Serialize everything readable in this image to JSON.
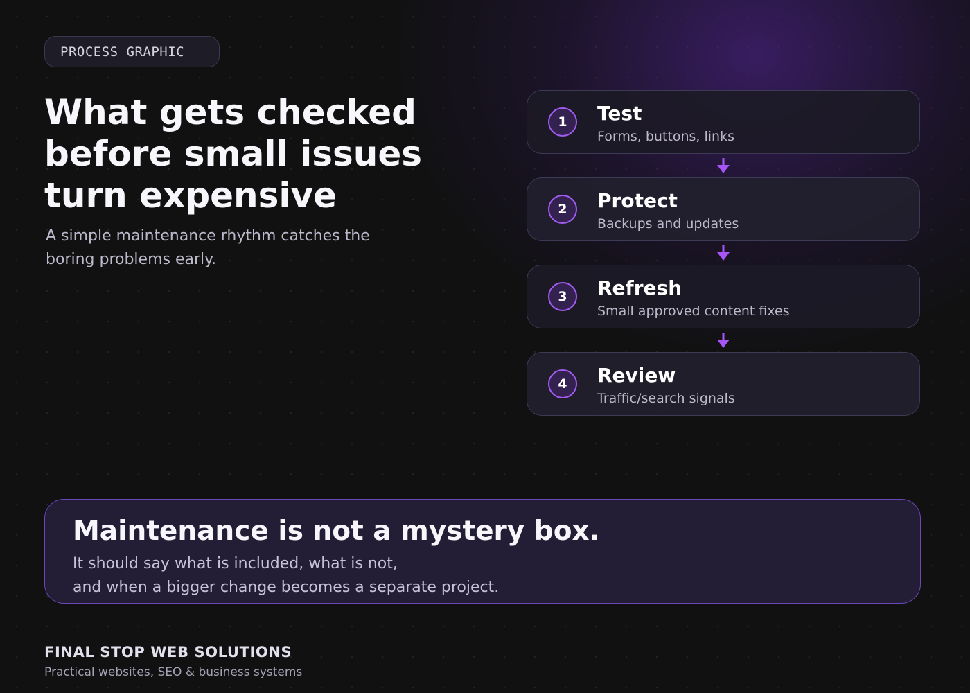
{
  "tag": "PROCESS GRAPHIC",
  "headline": "What gets checked before small issues turn expensive",
  "subhead": "A simple maintenance rhythm catches the boring problems early.",
  "steps": [
    {
      "number": "1",
      "title": "Test",
      "description": "Forms, buttons, links"
    },
    {
      "number": "2",
      "title": "Protect",
      "description": "Backups and updates"
    },
    {
      "number": "3",
      "title": "Refresh",
      "description": "Small approved content fixes"
    },
    {
      "number": "4",
      "title": "Review",
      "description": "Traffic/search signals"
    }
  ],
  "callout": {
    "title": "Maintenance is not a mystery box.",
    "body_line_1": "It should say what is included, what is not,",
    "body_line_2": "and when a bigger change becomes a separate project."
  },
  "footer": {
    "brand": "FINAL STOP WEB SOLUTIONS",
    "tagline": "Practical websites, SEO & business systems"
  },
  "colors": {
    "background": "#111112",
    "accent": "#a35cf0",
    "arrow": "#a855f7",
    "glow": "#58269f"
  },
  "icons": {
    "connector": "arrow-down-icon"
  }
}
